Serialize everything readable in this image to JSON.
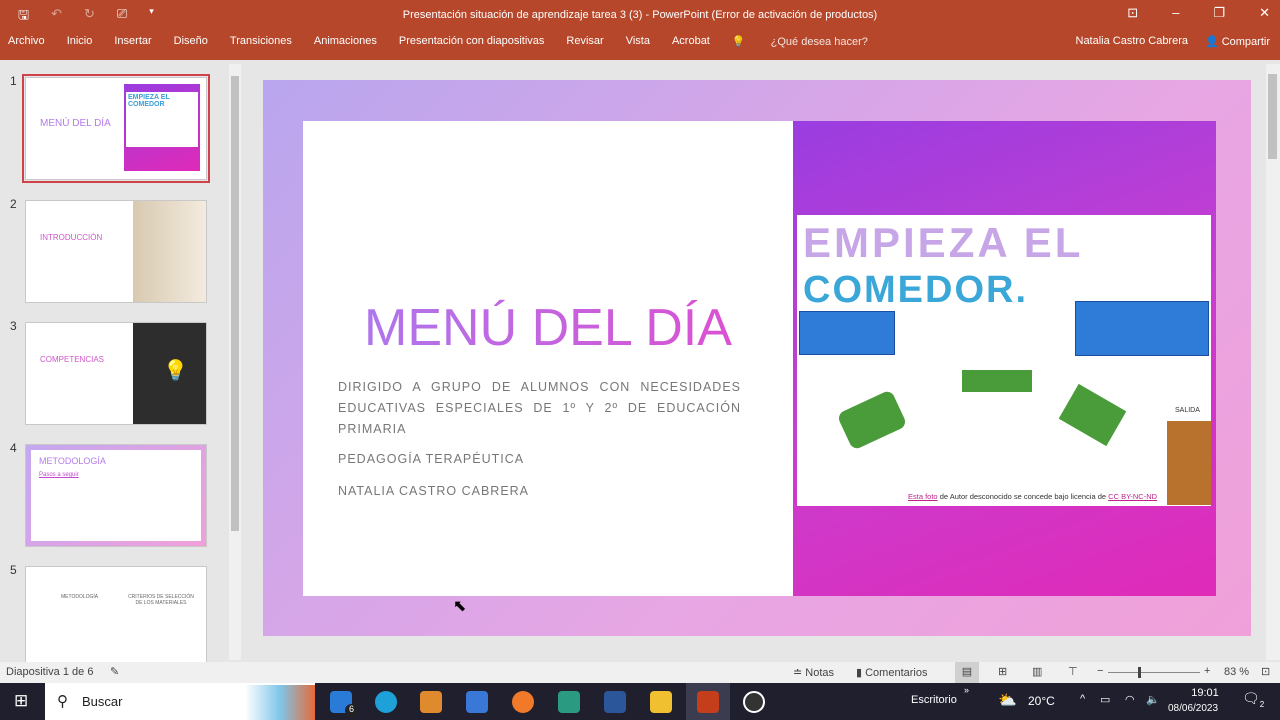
{
  "window": {
    "title": "Presentación situación de aprendizaje tarea 3 (3) - PowerPoint (Error de activación de productos)"
  },
  "ribbon": {
    "tabs": [
      "Archivo",
      "Inicio",
      "Insertar",
      "Diseño",
      "Transiciones",
      "Animaciones",
      "Presentación con diapositivas",
      "Revisar",
      "Vista",
      "Acrobat"
    ],
    "tell_me": "¿Qué desea hacer?",
    "user": "Natalia Castro Cabrera",
    "share": "Compartir"
  },
  "thumbnails": [
    {
      "num": "1",
      "title": "MENÚ DEL DÍA",
      "image_text": "EMPIEZA EL COMEDOR"
    },
    {
      "num": "2",
      "title": "INTRODUCCIÓN"
    },
    {
      "num": "3",
      "title": "COMPETENCIAS"
    },
    {
      "num": "4",
      "title": "METODOLOGÍA",
      "subtitle": "Pasos a seguir"
    },
    {
      "num": "5",
      "title": "METODOLOGÍA",
      "title2": "CRITERIOS DE SELECCIÓN DE LOS MATERIALES"
    }
  ],
  "slide": {
    "title": "MENÚ DEL DÍA",
    "subtitle1": "DIRIGIDO A GRUPO DE ALUMNOS CON NECESIDADES EDUCATIVAS ESPECIALES DE 1º Y 2º DE EDUCACIÓN PRIMARIA",
    "subtitle2": "PEDAGOGÍA TERAPÉUTICA",
    "subtitle3": "NATALIA CASTRO CABRERA",
    "drawing_text1": "EMPIEZA EL",
    "drawing_text2": "COMEDOR.",
    "drawing_label": "SALIDA",
    "credit_link1": "Esta foto",
    "credit_mid": " de Autor desconocido se concede bajo licencia de ",
    "credit_link2": "CC BY-NC-ND"
  },
  "status": {
    "slide": "Diapositiva 1 de 6",
    "notes": "Notas",
    "comments": "Comentarios",
    "zoom": "83 %",
    "zoom_value": 83
  },
  "taskbar": {
    "search": "Buscar",
    "mail_badge": "6",
    "desktop": "Escritorio",
    "weather": "20°C",
    "time": "19:01",
    "date": "08/06/2023",
    "notif": "2"
  }
}
